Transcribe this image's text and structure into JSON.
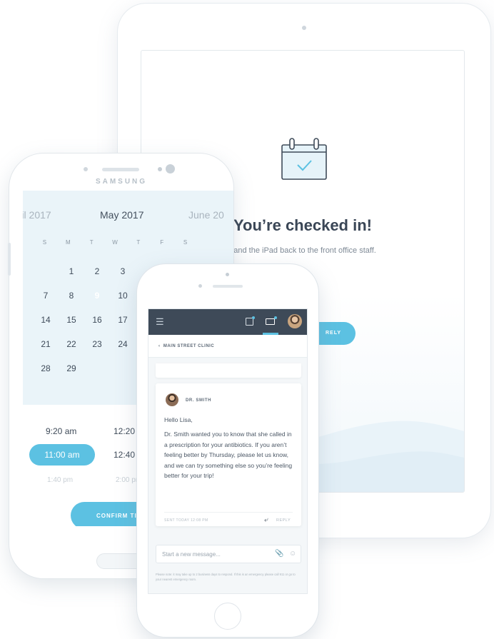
{
  "ipad": {
    "title": "You’re checked in!",
    "subtitle": "hand the iPad back to the front office staff.",
    "button_label": "RELY"
  },
  "samsung": {
    "brand": "SAMSUNG",
    "calendar": {
      "prev_month": "pril 2017",
      "current_month": "May 2017",
      "next_month": "June 20",
      "weekdays": [
        "S",
        "M",
        "T",
        "W",
        "T",
        "F",
        "S"
      ],
      "rows": [
        [
          "",
          "1",
          "2",
          "3",
          "",
          "",
          ""
        ],
        [
          "7",
          "8",
          "9",
          "10",
          "",
          "",
          ""
        ],
        [
          "14",
          "15",
          "16",
          "17",
          "",
          "",
          ""
        ],
        [
          "21",
          "22",
          "23",
          "24",
          "",
          "",
          ""
        ],
        [
          "28",
          "29",
          "",
          "",
          "",
          "",
          ""
        ]
      ],
      "selected_day": "9"
    },
    "times": {
      "row1": [
        "9:20 am",
        "12:20 pm"
      ],
      "row2": [
        "11:00 am",
        "12:40 pm"
      ],
      "row3": [
        "1:40 pm",
        "2:00 pm"
      ],
      "selected": "11:00 am"
    },
    "confirm_label": "CONFIRM TI"
  },
  "iphone": {
    "nav": {
      "menu_icon": "hamburger-icon",
      "icons": [
        "calendar-notify-icon",
        "inbox-notify-icon"
      ]
    },
    "back_label": "MAIN STREET CLINIC",
    "message": {
      "sender": "DR. SMITH",
      "greeting": "Hello Lisa,",
      "body": "Dr. Smith wanted you to know that she called in a prescription for your antibiotics. If you aren’t feeling better by Thursday, please let us know, and we can try something else so you’re feeling better for your trip!",
      "time": "SENT TODAY 12:08 PM",
      "reply_label": "REPLY"
    },
    "compose_placeholder": "Start a new message...",
    "note": "Please note: it may take up to 2 business days to respond. If this is an emergency please call 911 or go to your nearest emergency room."
  },
  "colors": {
    "accent": "#5cc1e2",
    "nav_dark": "#3e4a58",
    "text": "#3d4a5a"
  }
}
